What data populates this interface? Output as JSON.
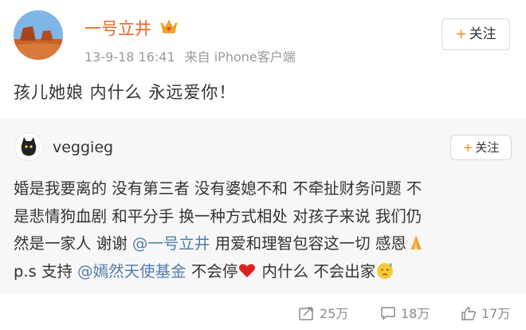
{
  "post": {
    "author": "一号立井",
    "time": "13-9-18 16:41",
    "source": "来自 iPhone客户端",
    "follow_label": "关注",
    "text": "孩儿她娘 内什么 永远爱你！"
  },
  "repost": {
    "author": "veggieg",
    "follow_label": "关注",
    "line1": "婚是我要离的 没有第三者 没有婆媳不和 不牵扯财务问题 不",
    "line2": "是悲情狗血剧 和平分手 换一种方式相处 对孩子来说 我们仍",
    "line3_a": "然是一家人 谢谢 ",
    "line3_mention": "@一号立井",
    "line3_b": " 用爱和理智包容这一切 感恩",
    "line4_a": "p.s 支持 ",
    "line4_mention": "@嫣然天使基金",
    "line4_b": " 不会停",
    "line4_c": " 内什么 不会出家"
  },
  "actions": {
    "repost_count": "25万",
    "comment_count": "18万",
    "like_count": "17万"
  },
  "colors": {
    "author_name": "#e8672a",
    "mention": "#507daf",
    "follow_plus": "#ff8200",
    "repost_bg": "#f7f7f7"
  },
  "icons": [
    "crown-icon",
    "repost-icon",
    "comment-icon",
    "like-icon",
    "pray-emoji",
    "heart-emoji",
    "sweat-emoji"
  ]
}
